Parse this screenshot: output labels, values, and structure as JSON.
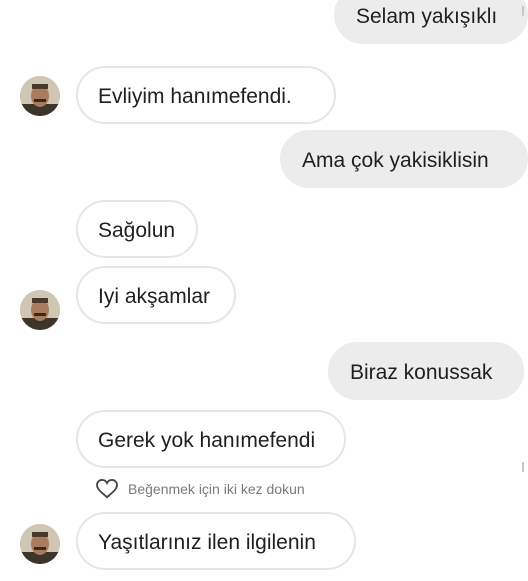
{
  "messages": [
    {
      "text": "Selam yakışıklı",
      "side": "sent"
    },
    {
      "text": "Evliyim hanımefendi.",
      "side": "received"
    },
    {
      "text": "Ama çok yakisiklisin",
      "side": "sent"
    },
    {
      "text": "Sağolun",
      "side": "received"
    },
    {
      "text": "Iyi akşamlar",
      "side": "received"
    },
    {
      "text": "Biraz konussak",
      "side": "sent"
    },
    {
      "text": "Gerek yok hanımefendi",
      "side": "received"
    },
    {
      "text": "Yaşıtlarınız ilen ilgilenin",
      "side": "received"
    }
  ],
  "like_hint": {
    "icon": "heart-outline-icon",
    "text": "Beğenmek için iki kez dokun"
  },
  "avatar": {
    "icon": "profile-photo-avatar"
  },
  "colors": {
    "sent_bubble": "#ececec",
    "received_bubble_border": "#e6e6e6",
    "text": "#1f1f1f",
    "hint_text": "#7a7a7a"
  }
}
